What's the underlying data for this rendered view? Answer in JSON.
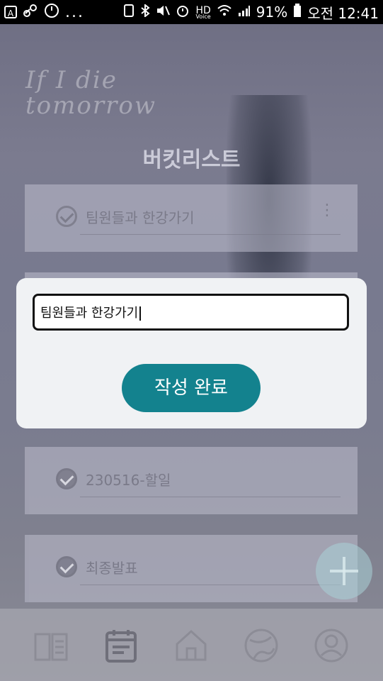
{
  "statusbar": {
    "left_icons": [
      "a-icon",
      "link-icon",
      "timer-icon",
      "more-dots"
    ],
    "dots": "...",
    "right": {
      "hd_label": "HD",
      "voice_label": "Voice",
      "battery_percent": "91%",
      "time": "오전 12:41"
    }
  },
  "app": {
    "brand_line1": "If I die",
    "brand_line2": "tomorrow",
    "title": "버킷리스트"
  },
  "list": {
    "items": [
      {
        "label": "팀원들과 한강가기",
        "completed": false
      },
      {
        "label": "230516-할일",
        "completed": true
      },
      {
        "label": "최종발표",
        "completed": true
      }
    ]
  },
  "dialog": {
    "input_value": "팀원들과 한강가기",
    "submit_label": "작성 완료"
  },
  "bottom_nav": {
    "items": [
      "book-icon",
      "calendar-icon",
      "home-icon",
      "globe-icon",
      "profile-icon"
    ]
  },
  "colors": {
    "accent": "#13828e",
    "dialog_bg": "#f0f2f4"
  }
}
